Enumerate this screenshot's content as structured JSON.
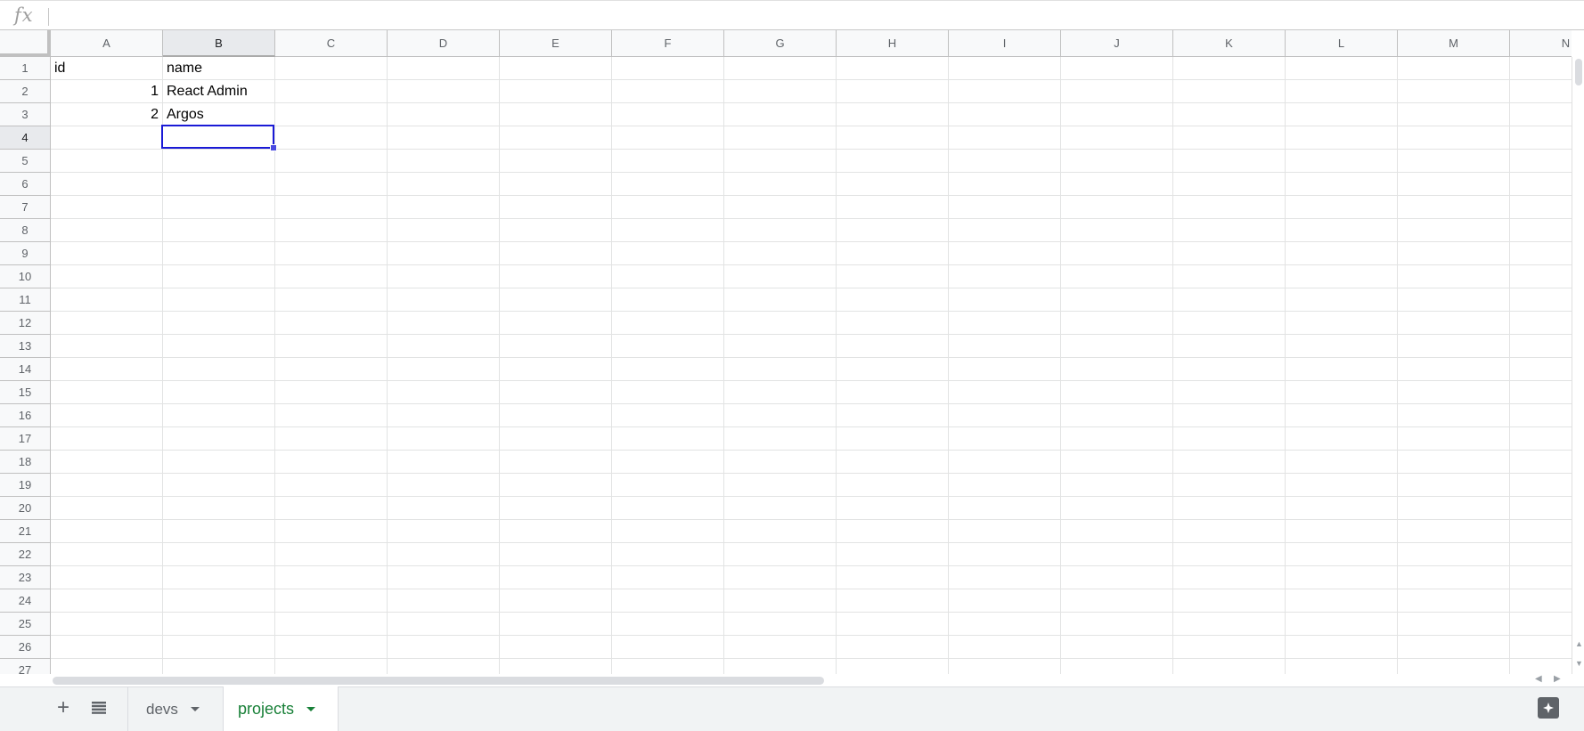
{
  "formula_bar": {
    "fx_label": "fx",
    "value": ""
  },
  "columns": [
    "A",
    "B",
    "C",
    "D",
    "E",
    "F",
    "G",
    "H",
    "I",
    "J",
    "K",
    "L",
    "M",
    "N"
  ],
  "rows": [
    "1",
    "2",
    "3",
    "4",
    "5",
    "6",
    "7",
    "8",
    "9",
    "10",
    "11",
    "12",
    "13",
    "14",
    "15",
    "16",
    "17",
    "18",
    "19",
    "20",
    "21",
    "22",
    "23",
    "24",
    "25",
    "26",
    "27"
  ],
  "cells": [
    [
      "id",
      "name"
    ],
    [
      "1",
      "React Admin"
    ],
    [
      "2",
      "Argos"
    ]
  ],
  "selection": {
    "column": "B",
    "row": "4"
  },
  "sheets": [
    {
      "name": "devs",
      "active": false
    },
    {
      "name": "projects",
      "active": true
    }
  ],
  "icons": {
    "add_sheet": "plus-icon",
    "all_sheets": "menu-list-icon",
    "explore": "explore-icon"
  },
  "colors": {
    "active_tab": "#188038",
    "selection": "#1a1ad6"
  }
}
